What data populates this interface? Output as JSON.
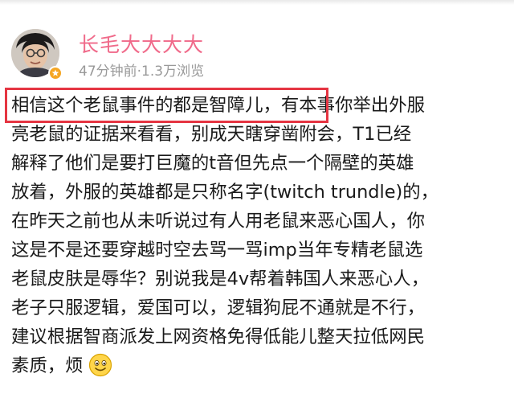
{
  "post": {
    "username": "长毛大大大大",
    "time_ago": "47分钟前",
    "separator": " · ",
    "views": "1.3万浏览",
    "lines": [
      "相信这个老鼠事件的都是智障儿，有本事你举出外服",
      "亮老鼠的证据来看看，别成天瞎穿凿附会，T1已经",
      "解释了他们是要打巨魔的t音但先点一个隔壁的英雄",
      "放着，外服的英雄都是只称名字(twitch trundle)的，",
      "在昨天之前也从未听说过有人用老鼠来恶心国人，你",
      "这是不是还要穿越时空去骂一骂imp当年专精老鼠选",
      "老鼠皮肤是辱华？别说我是4v帮着韩国人来恶心人，",
      "老子只服逻辑，爱国可以，逻辑狗屁不通就是不行，",
      "建议根据智商派发上网资格免得低能儿整天拉低网民",
      "素质，烦"
    ],
    "emoji": "smile-emoji"
  },
  "colors": {
    "username": "#f06a8a",
    "meta": "#999999",
    "text": "#1a1a1a",
    "highlight_border": "#e53542",
    "badge": "#f5a623"
  }
}
